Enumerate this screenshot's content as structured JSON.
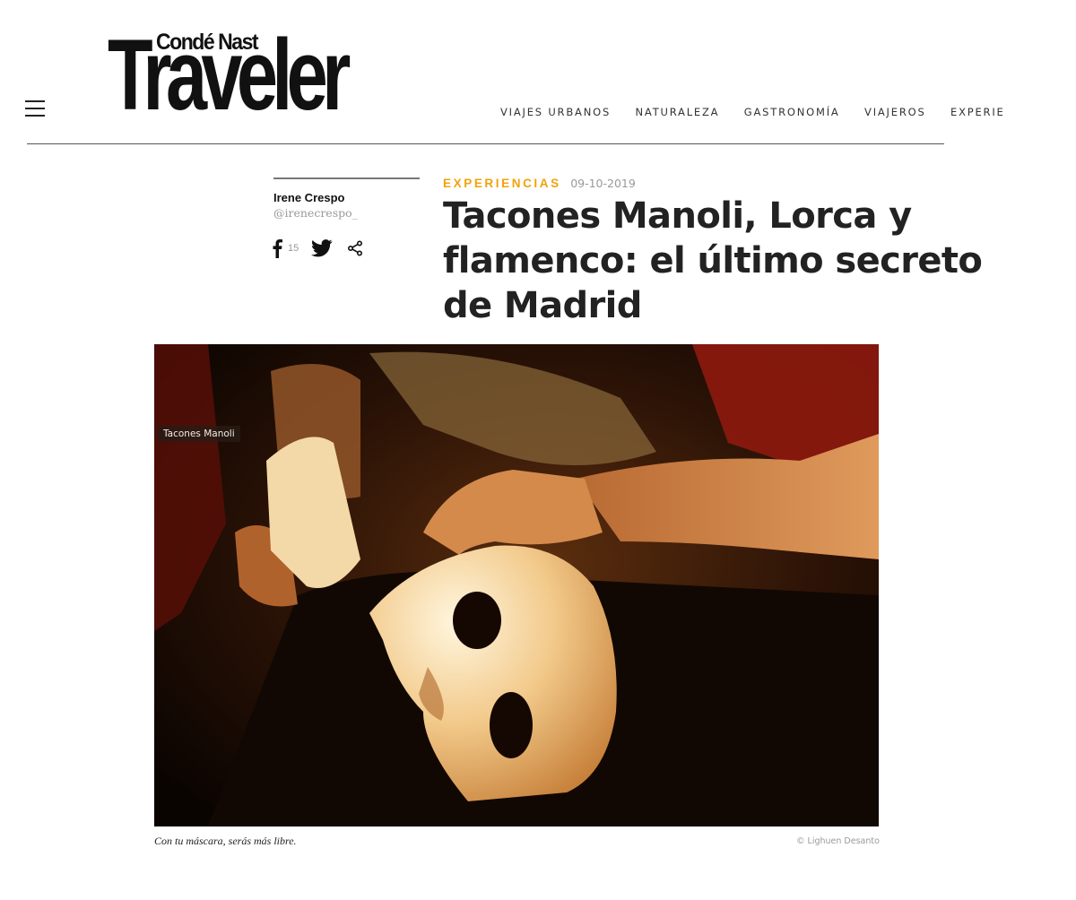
{
  "header": {
    "logo_top": "Condé Nast",
    "logo_main": "Traveler",
    "nav": [
      "VIAJES URBANOS",
      "NATURALEZA",
      "GASTRONOMÍA",
      "VIAJEROS",
      "EXPERIENCIAS"
    ]
  },
  "author": {
    "name": "Irene Crespo",
    "handle": "@irenecrespo_",
    "facebook_count": "15"
  },
  "article": {
    "section": "EXPERIENCIAS",
    "date": "09-10-2019",
    "title": "Tacones Manoli, Lorca y flamenco: el último secreto de Madrid"
  },
  "hero": {
    "tag": "Tacones Manoli",
    "caption": "Con tu máscara, serás más libre.",
    "credit": "© Lighuen Desanto"
  },
  "icons": {
    "menu": "hamburger-menu-icon",
    "facebook": "facebook-icon",
    "twitter": "twitter-icon",
    "share": "share-icon"
  },
  "colors": {
    "accent": "#f0a30a",
    "text": "#222222",
    "muted": "#999999"
  }
}
